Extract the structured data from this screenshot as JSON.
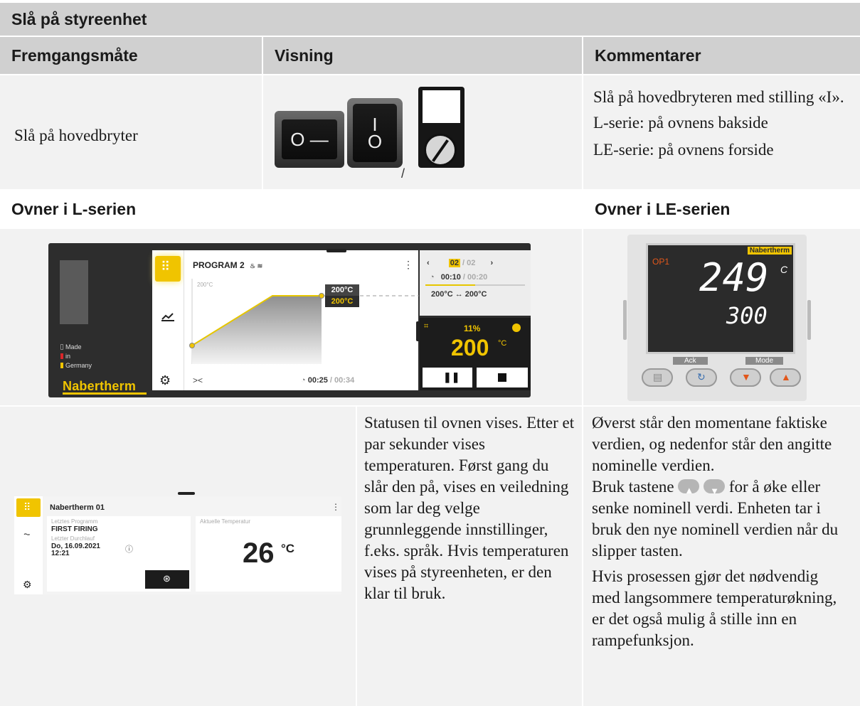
{
  "section_title": "Slå på styreenhet",
  "columns": {
    "procedure": "Fremgangsmåte",
    "display": "Visning",
    "comments": "Kommentarer"
  },
  "row1": {
    "procedure": "Slå på hovedbryter",
    "switch1_label": "O —",
    "switch2_top": "I",
    "switch2_bottom": "O",
    "separator": "/",
    "comments": [
      "Slå på hovedbryteren med stilling «I».",
      "L-serie: på ovnens bakside",
      "LE-serie: på ovnens forside"
    ]
  },
  "subheaders": {
    "l_series": "Ovner i L-serien",
    "le_series": "Ovner i LE-serien"
  },
  "l_panel": {
    "legend": [
      "Made",
      "in",
      "Germany"
    ],
    "brand": "Nabertherm",
    "program_title": "PROGRAM 2",
    "chart_start_label": "200°C",
    "set_temp_1": "200°C",
    "set_temp_2": "200°C",
    "elapsed": "00:25",
    "total": "00:34",
    "segment_current": "02",
    "segment_total": "02",
    "segment_time": "00:10",
    "segment_time_total": "00:20",
    "segment_range": "200°C ↔ 200°C",
    "power": "11%",
    "temperature": "200",
    "temp_unit": "°C",
    "colors": {
      "accent": "#f0c400",
      "dark": "#2d2d2d"
    }
  },
  "le_panel": {
    "brand": "Nabertherm",
    "program": "OP1",
    "actual": "249",
    "unit": "C",
    "setpoint": "300",
    "ack": "Ack",
    "mode": "Mode"
  },
  "row3": {
    "mini_ui": {
      "title": "Nabertherm 01",
      "last_program_label": "Letztes Programm",
      "last_program": "FIRST FIRING",
      "last_run_label": "Letzter Durchlauf",
      "last_run_date": "Do, 16.09.2021",
      "last_run_time": "12:21",
      "current_temp_label": "Aktuelle Temperatur",
      "current_temp": "26",
      "current_temp_unit": "°C"
    },
    "status_text": "Statusen til ovnen vises. Etter et par sekunder vises temperaturen. Først gang du slår den på, vises en veiledning som lar deg velge grunnleggende innstillinger, f.eks. språk. Hvis temperaturen vises på styreenheten, er den klar til bruk.",
    "le_text_1": "Øverst står den momentane faktiske verdien, og nedenfor står den angitte nominelle verdien.",
    "le_text_2a": "Bruk tastene",
    "le_text_2b": "for å øke eller senke nominell verdi. Enheten tar i bruk den nye nominell verdien når du slipper tasten.",
    "le_text_3": "Hvis prosessen gjør det nødvendig med langsommere temperaturøkning, er det også mulig å stille inn en rampefunksjon."
  }
}
